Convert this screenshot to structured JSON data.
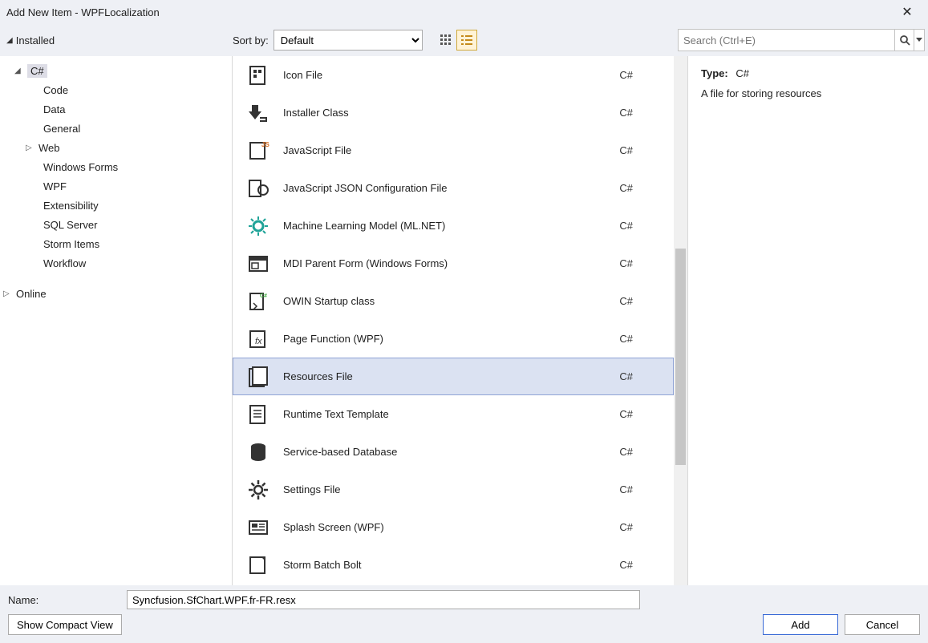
{
  "window": {
    "title": "Add New Item - WPFLocalization"
  },
  "toolbar": {
    "tree_header": "Installed",
    "sort_label": "Sort by:",
    "sort_value": "Default",
    "search_placeholder": "Search (Ctrl+E)"
  },
  "tree": {
    "installed": "Installed",
    "csharp": "C#",
    "items": [
      "Code",
      "Data",
      "General",
      "Web",
      "Windows Forms",
      "WPF",
      "Extensibility",
      "SQL Server",
      "Storm Items",
      "Workflow"
    ],
    "online": "Online"
  },
  "templates": [
    {
      "name": "Icon File",
      "lang": "C#",
      "icon": "icon-file"
    },
    {
      "name": "Installer Class",
      "lang": "C#",
      "icon": "installer"
    },
    {
      "name": "JavaScript File",
      "lang": "C#",
      "icon": "js-file"
    },
    {
      "name": "JavaScript JSON Configuration File",
      "lang": "C#",
      "icon": "json-file"
    },
    {
      "name": "Machine Learning Model (ML.NET)",
      "lang": "C#",
      "icon": "ml"
    },
    {
      "name": "MDI Parent Form (Windows Forms)",
      "lang": "C#",
      "icon": "mdi"
    },
    {
      "name": "OWIN Startup class",
      "lang": "C#",
      "icon": "owin"
    },
    {
      "name": "Page Function (WPF)",
      "lang": "C#",
      "icon": "pagefunc"
    },
    {
      "name": "Resources File",
      "lang": "C#",
      "icon": "resources",
      "selected": true
    },
    {
      "name": "Runtime Text Template",
      "lang": "C#",
      "icon": "runtime-tt"
    },
    {
      "name": "Service-based Database",
      "lang": "C#",
      "icon": "database"
    },
    {
      "name": "Settings File",
      "lang": "C#",
      "icon": "settings"
    },
    {
      "name": "Splash Screen (WPF)",
      "lang": "C#",
      "icon": "splash"
    },
    {
      "name": "Storm Batch Bolt",
      "lang": "C#",
      "icon": "storm"
    }
  ],
  "details": {
    "type_label": "Type:",
    "type_value": "C#",
    "description": "A file for storing resources"
  },
  "bottom": {
    "name_label": "Name:",
    "name_value": "Syncfusion.SfChart.WPF.fr-FR.resx",
    "compact_btn": "Show Compact View",
    "add_btn": "Add",
    "cancel_btn": "Cancel"
  }
}
